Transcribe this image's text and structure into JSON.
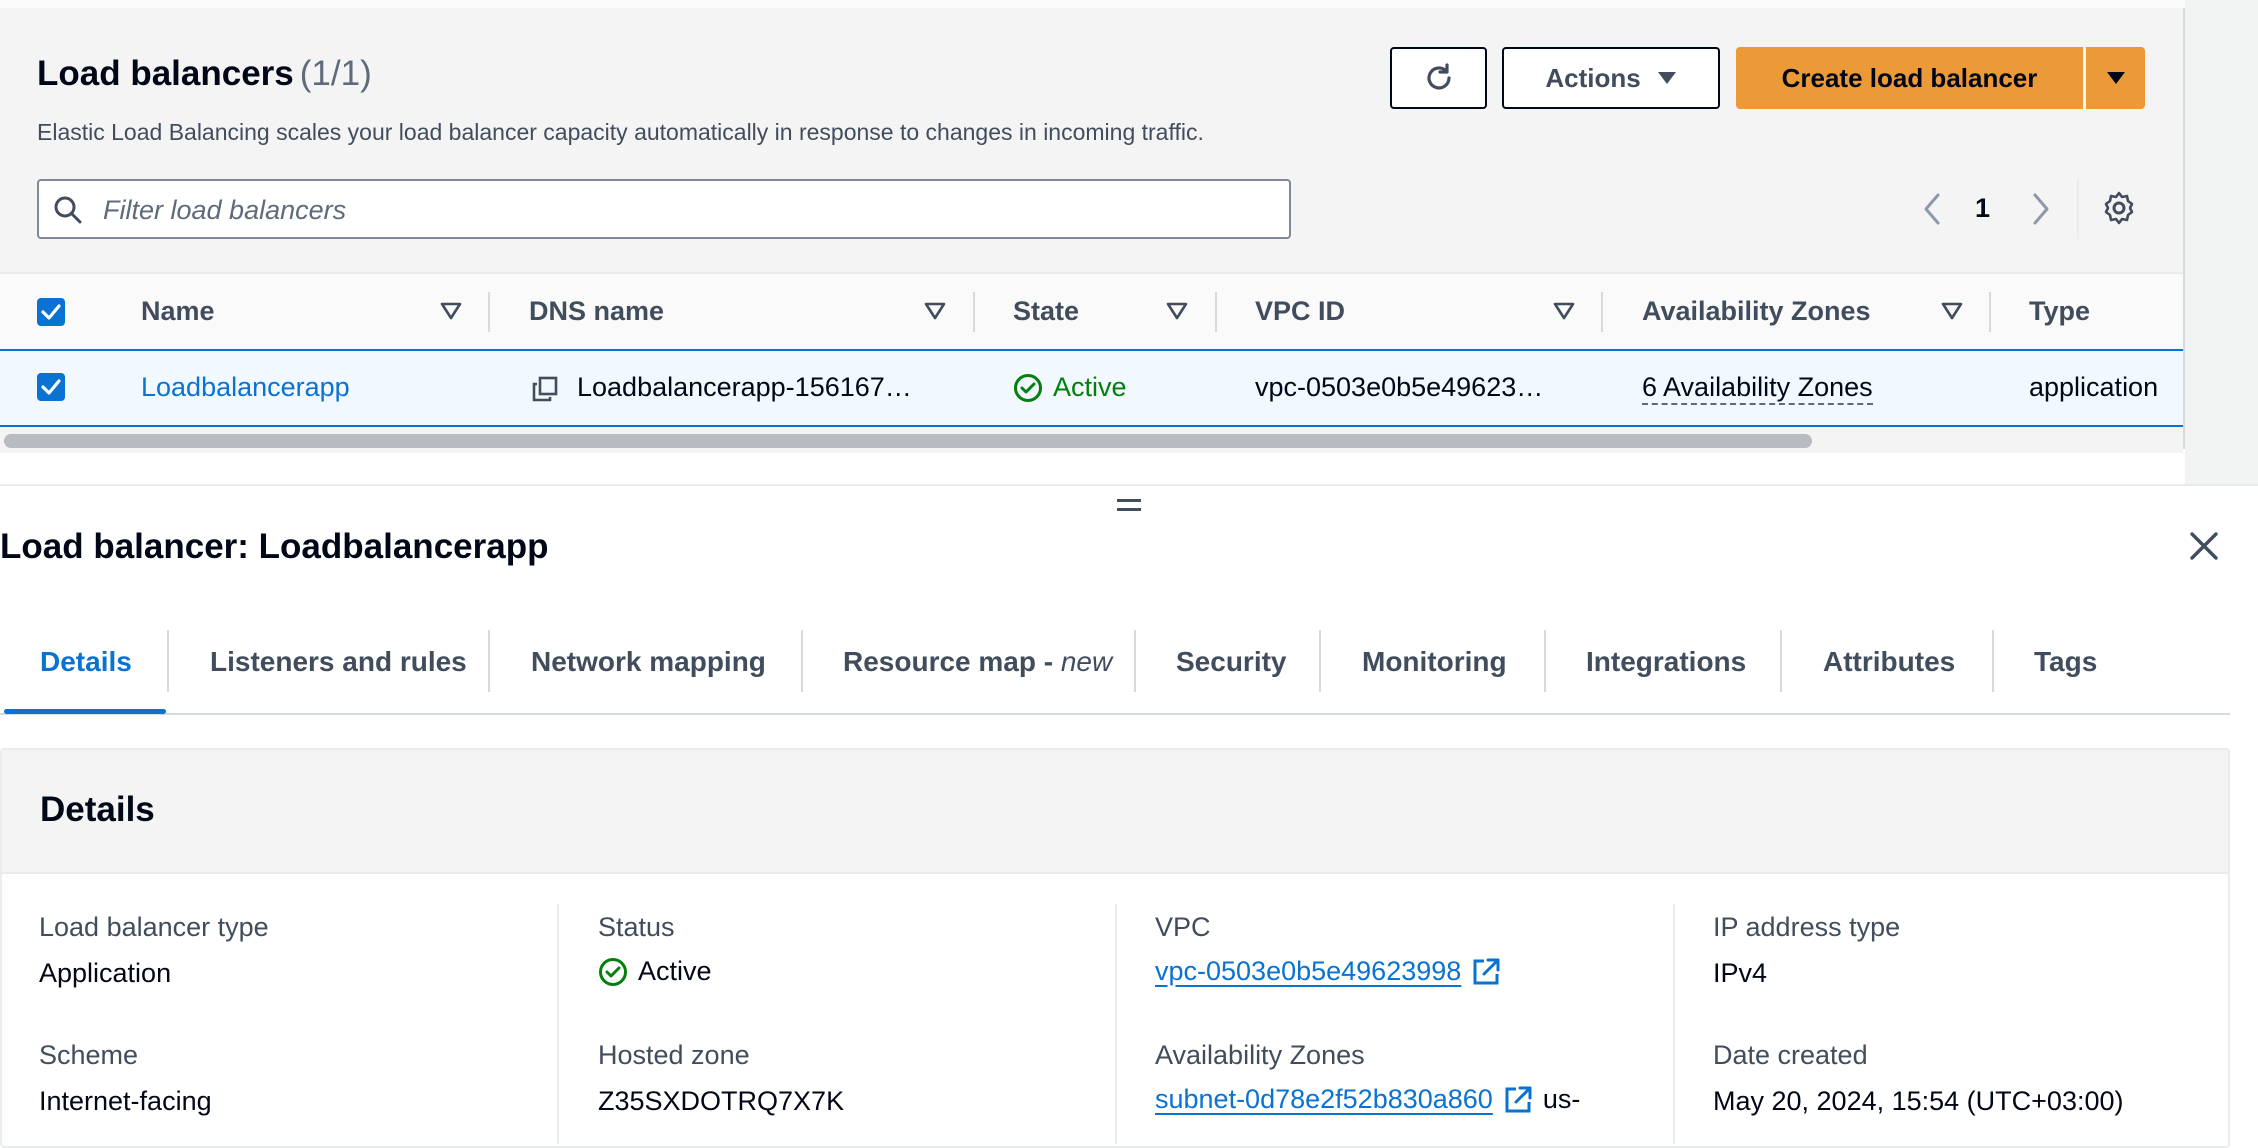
{
  "list": {
    "title": "Load balancers",
    "count": "(1/1)",
    "description": "Elastic Load Balancing scales your load balancer capacity automatically in response to changes in incoming traffic.",
    "actions_label": "Actions",
    "create_label": "Create load balancer",
    "search_placeholder": "Filter load balancers",
    "page_number": "1"
  },
  "table": {
    "columns": [
      "Name",
      "DNS name",
      "State",
      "VPC ID",
      "Availability Zones",
      "Type"
    ],
    "rows": [
      {
        "name": "Loadbalancerapp",
        "dns_name": "Loadbalancerapp-156167…",
        "state": "Active",
        "vpc_id": "vpc-0503e0b5e49623…",
        "availability_zones": "6 Availability Zones",
        "type": "application"
      }
    ]
  },
  "detail": {
    "title": "Load balancer: Loadbalancerapp",
    "tabs": [
      "Details",
      "Listeners and rules",
      "Network mapping",
      "Resource map - ",
      "Security",
      "Monitoring",
      "Integrations",
      "Attributes",
      "Tags"
    ],
    "resource_map_suffix": "new",
    "section_title": "Details",
    "fields": {
      "lb_type_label": "Load balancer type",
      "lb_type_value": "Application",
      "scheme_label": "Scheme",
      "scheme_value": "Internet-facing",
      "status_label": "Status",
      "status_value": "Active",
      "hosted_zone_label": "Hosted zone",
      "hosted_zone_value": "Z35SXDOTRQ7X7K",
      "vpc_label": "VPC",
      "vpc_value": "vpc-0503e0b5e49623998",
      "az_label": "Availability Zones",
      "az_subnet": "subnet-0d78e2f52b830a860",
      "az_suffix": "us-",
      "ip_type_label": "IP address type",
      "ip_type_value": "IPv4",
      "date_label": "Date created",
      "date_value": "May 20, 2024, 15:54 (UTC+03:00)"
    }
  },
  "colors": {
    "accent": "#0972d3",
    "primary_button": "#ec9a37",
    "success": "#037f0c"
  }
}
